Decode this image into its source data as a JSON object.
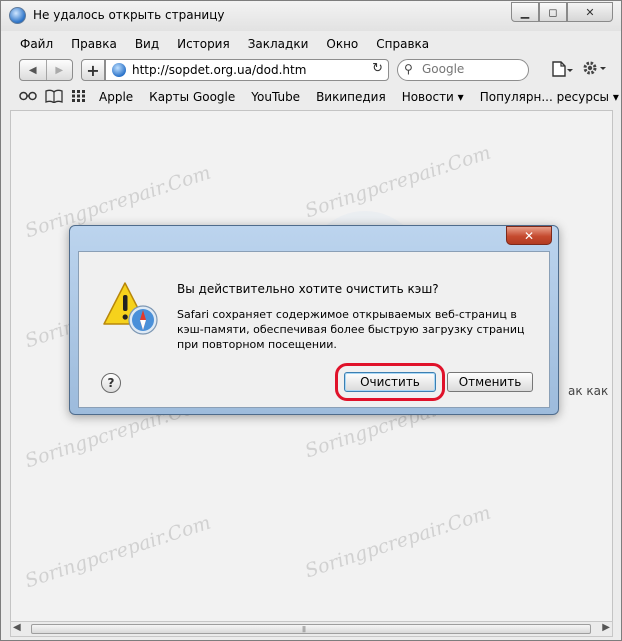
{
  "window": {
    "title": "Не удалось открыть страницу",
    "controls": {
      "minimize": "▁",
      "maximize": "◻",
      "close": "✕"
    }
  },
  "menu": [
    "Файл",
    "Правка",
    "Вид",
    "История",
    "Закладки",
    "Окно",
    "Справка"
  ],
  "toolbar": {
    "back": "◀",
    "forward": "▶",
    "add": "+",
    "url": "http://sopdet.org.ua/dod.htm",
    "reload": "↻",
    "search_placeholder": "Google",
    "search_icon": "⚲"
  },
  "bookmarks": {
    "icons": [
      "reading-list-icon",
      "book-icon",
      "top-sites-icon"
    ],
    "items": [
      "Apple",
      "Карты Google",
      "YouTube",
      "Википедия",
      "Новости ▾",
      "Популярн... ресурсы ▾"
    ]
  },
  "content": {
    "partial_text": "ак как"
  },
  "watermark": "Soringpcrepair.Com",
  "dialog": {
    "title": "Вы действительно хотите очистить кэш?",
    "message": "Safari сохраняет содержимое открываемых веб-страниц в кэш-памяти, обеспечивая более быструю загрузку страниц при повторном посещении.",
    "help": "?",
    "confirm_label": "Очистить",
    "cancel_label": "Отменить",
    "close": "✕"
  },
  "colors": {
    "dialog_frame": "#9dbbdc",
    "close_button": "#c54a2f",
    "highlight_ring": "#e0122a"
  }
}
